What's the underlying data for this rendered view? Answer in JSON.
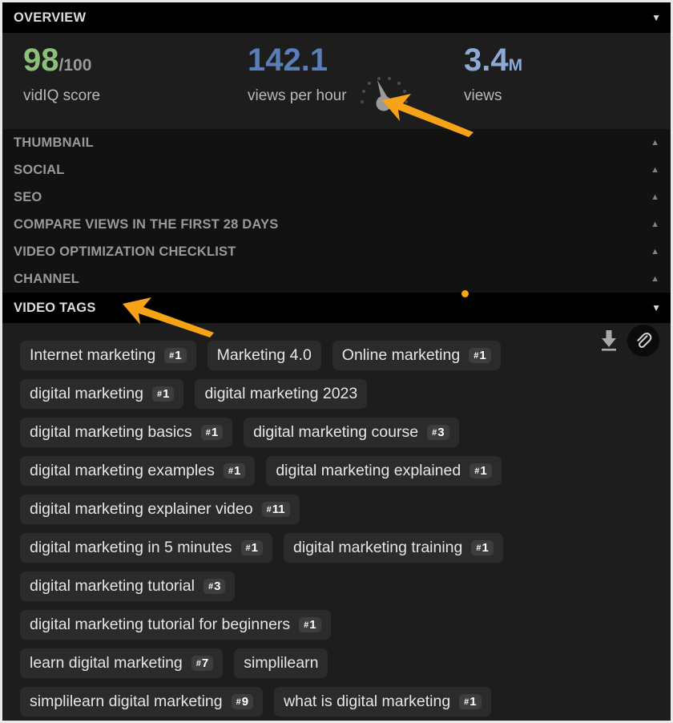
{
  "overview": {
    "title": "OVERVIEW",
    "caret": "▼",
    "stats": [
      {
        "name": "vidiq-score",
        "value": "98",
        "suffix": "/100",
        "label": "vidIQ score",
        "value_color": "#8cc07a",
        "suffix_color": "#9a9a9a"
      },
      {
        "name": "views-per-hour",
        "value": "142.1",
        "suffix": "",
        "label": "views per hour",
        "value_color": "#5a7fb8",
        "suffix_color": "#5a7fb8"
      },
      {
        "name": "views",
        "value": "3.4",
        "suffix": "M",
        "label": "views",
        "value_color": "#8da9d4",
        "suffix_color": "#8da9d4"
      }
    ]
  },
  "sections": [
    {
      "label": "THUMBNAIL",
      "caret": "▲",
      "expanded": false
    },
    {
      "label": "SOCIAL",
      "caret": "▲",
      "expanded": false
    },
    {
      "label": "SEO",
      "caret": "▲",
      "expanded": false
    },
    {
      "label": "COMPARE VIEWS IN THE FIRST 28 DAYS",
      "caret": "▲",
      "expanded": false
    },
    {
      "label": "VIDEO OPTIMIZATION CHECKLIST",
      "caret": "▲",
      "expanded": false
    },
    {
      "label": "CHANNEL",
      "caret": "▲",
      "expanded": false
    }
  ],
  "video_tags": {
    "title": "VIDEO TAGS",
    "caret": "▼",
    "tools": [
      {
        "name": "download-icon",
        "label": "download"
      },
      {
        "name": "paperclip-icon",
        "label": "attach"
      }
    ],
    "rows": [
      [
        {
          "text": "Internet marketing",
          "rank": "1"
        },
        {
          "text": "Marketing 4.0",
          "rank": null
        },
        {
          "text": "Online marketing",
          "rank": "1"
        }
      ],
      [
        {
          "text": "digital marketing",
          "rank": "1"
        },
        {
          "text": "digital marketing 2023",
          "rank": null
        }
      ],
      [
        {
          "text": "digital marketing basics",
          "rank": "1"
        },
        {
          "text": "digital marketing course",
          "rank": "3"
        }
      ],
      [
        {
          "text": "digital marketing examples",
          "rank": "1"
        },
        {
          "text": "digital marketing explained",
          "rank": "1"
        }
      ],
      [
        {
          "text": "digital marketing explainer video",
          "rank": "11"
        }
      ],
      [
        {
          "text": "digital marketing in 5 minutes",
          "rank": "1"
        },
        {
          "text": "digital marketing training",
          "rank": "1"
        }
      ],
      [
        {
          "text": "digital marketing tutorial",
          "rank": "3"
        }
      ],
      [
        {
          "text": "digital marketing tutorial for beginners",
          "rank": "1"
        }
      ],
      [
        {
          "text": "learn digital marketing",
          "rank": "7"
        },
        {
          "text": "simplilearn",
          "rank": null
        }
      ],
      [
        {
          "text": "simplilearn digital marketing",
          "rank": "9"
        },
        {
          "text": "what is digital marketing",
          "rank": "1"
        }
      ]
    ]
  },
  "annotations": {
    "color": "#f7a317",
    "dot": {
      "name": "notification-dot"
    },
    "arrows": [
      {
        "name": "arrow-pointing-to-views-per-hour-gauge"
      },
      {
        "name": "arrow-pointing-to-video-tags"
      }
    ]
  }
}
